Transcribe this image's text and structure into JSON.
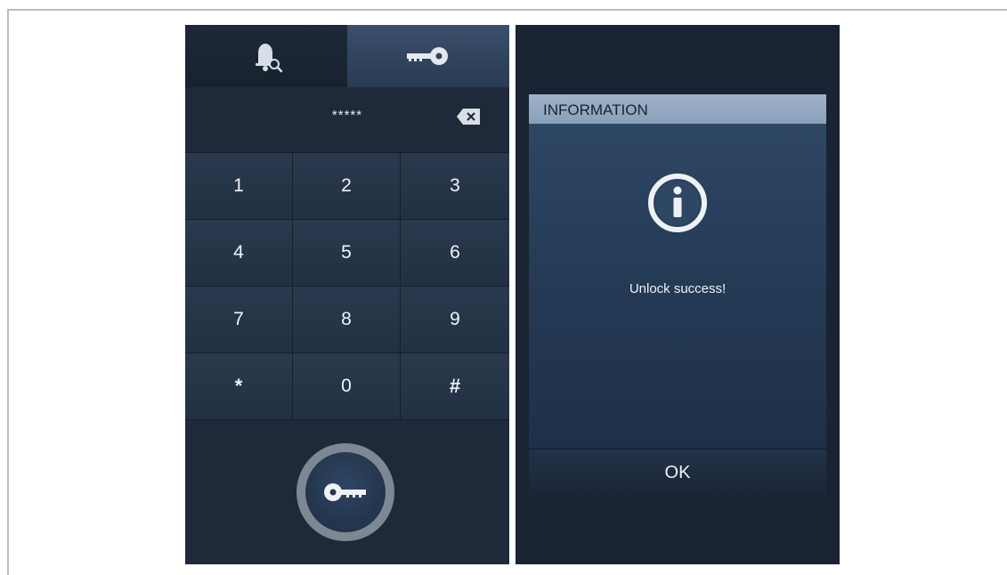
{
  "keypad_screen": {
    "tabs": [
      {
        "name": "call-log",
        "icon": "bell-search-icon"
      },
      {
        "name": "unlock",
        "icon": "key-icon",
        "active": true
      }
    ],
    "password_display": "*****",
    "backspace_icon": "backspace-icon",
    "keys": [
      "1",
      "2",
      "3",
      "4",
      "5",
      "6",
      "7",
      "8",
      "9",
      "*",
      "0",
      "#"
    ],
    "unlock_button_icon": "key-icon"
  },
  "dialog": {
    "title": "INFORMATION",
    "icon": "info-icon",
    "message": "Unlock success!",
    "ok_label": "OK"
  },
  "colors": {
    "screen_bg": "#1f2b3b",
    "active_tab": "#34475f",
    "dialog_header": "#9fb2c9",
    "dialog_body": "#2b4360"
  }
}
